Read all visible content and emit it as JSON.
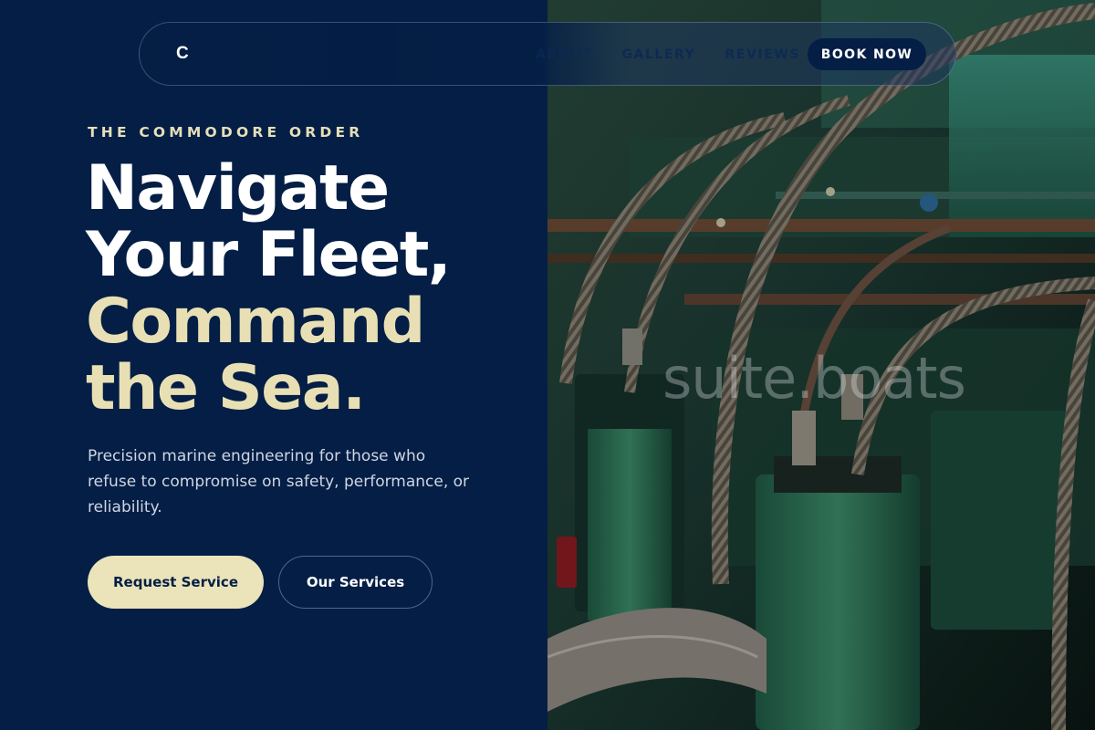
{
  "brand": {
    "mark": "C"
  },
  "nav": {
    "links": [
      "ABOUT",
      "GALLERY",
      "REVIEWS"
    ],
    "cta": "BOOK NOW"
  },
  "hero": {
    "eyebrow": "THE COMMODORE ORDER",
    "headline_line1": "Navigate",
    "headline_line2": "Your Fleet,",
    "headline_line3": "Command",
    "headline_line4": "the Sea.",
    "subtitle": "Precision marine engineering for those who refuse to compromise on safety, performance, or reliability.",
    "primary_button": "Request Service",
    "secondary_button": "Our Services"
  },
  "image": {
    "watermark": "suite.boats",
    "description_icon": "engine-room-photo"
  },
  "colors": {
    "navy": "#041e45",
    "cream": "#e8e0b4",
    "text_muted": "#cfd6e3"
  }
}
